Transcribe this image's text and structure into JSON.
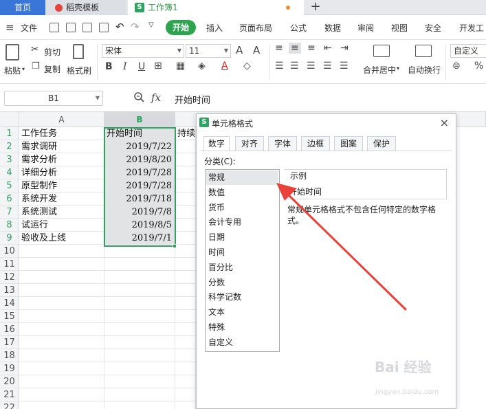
{
  "tabbar": {
    "home": "首页",
    "docer": "稻壳模板",
    "workbook": "工作簿1",
    "plus": "+"
  },
  "menubar": {
    "file": "文件",
    "start": "开始",
    "items": [
      "插入",
      "页面布局",
      "公式",
      "数据",
      "审阅",
      "视图",
      "安全",
      "开发工"
    ]
  },
  "ribbon": {
    "paste": "粘贴",
    "cut": "剪切",
    "copy": "复制",
    "format_painter": "格式刷",
    "font_name": "宋体",
    "font_size": "11",
    "merge": "合并居中",
    "wrap": "自动换行",
    "number_format": "自定义"
  },
  "formula_bar": {
    "name_box": "B1",
    "fx": "fx",
    "content": "开始时间"
  },
  "grid": {
    "col_a": "A",
    "col_b": "B",
    "rows": [
      {
        "n": "1",
        "a": "工作任务",
        "b": "开始时间",
        "c": "持续"
      },
      {
        "n": "2",
        "a": "需求调研",
        "b": "2019/7/22",
        "c": ""
      },
      {
        "n": "3",
        "a": "需求分析",
        "b": "2019/8/20",
        "c": ""
      },
      {
        "n": "4",
        "a": "详细分析",
        "b": "2019/7/28",
        "c": ""
      },
      {
        "n": "5",
        "a": "原型制作",
        "b": "2019/7/28",
        "c": ""
      },
      {
        "n": "6",
        "a": "系统开发",
        "b": "2019/7/18",
        "c": ""
      },
      {
        "n": "7",
        "a": "系统测试",
        "b": "2019/7/8",
        "c": ""
      },
      {
        "n": "8",
        "a": "试运行",
        "b": "2019/8/5",
        "c": ""
      },
      {
        "n": "9",
        "a": "验收及上线",
        "b": "2019/7/1",
        "c": ""
      },
      {
        "n": "10",
        "a": "",
        "b": "",
        "c": ""
      },
      {
        "n": "11",
        "a": "",
        "b": "",
        "c": ""
      },
      {
        "n": "12",
        "a": "",
        "b": "",
        "c": ""
      },
      {
        "n": "13",
        "a": "",
        "b": "",
        "c": ""
      },
      {
        "n": "14",
        "a": "",
        "b": "",
        "c": ""
      },
      {
        "n": "15",
        "a": "",
        "b": "",
        "c": ""
      },
      {
        "n": "16",
        "a": "",
        "b": "",
        "c": ""
      },
      {
        "n": "17",
        "a": "",
        "b": "",
        "c": ""
      },
      {
        "n": "18",
        "a": "",
        "b": "",
        "c": ""
      },
      {
        "n": "19",
        "a": "",
        "b": "",
        "c": ""
      },
      {
        "n": "20",
        "a": "",
        "b": "",
        "c": ""
      },
      {
        "n": "21",
        "a": "",
        "b": "",
        "c": ""
      },
      {
        "n": "22",
        "a": "",
        "b": "",
        "c": ""
      }
    ]
  },
  "dialog": {
    "title": "单元格格式",
    "close": "×",
    "tabs": [
      "数字",
      "对齐",
      "字体",
      "边框",
      "图案",
      "保护"
    ],
    "category_label": "分类(C):",
    "categories": [
      "常规",
      "数值",
      "货币",
      "会计专用",
      "日期",
      "时间",
      "百分比",
      "分数",
      "科学记数",
      "文本",
      "特殊",
      "自定义"
    ],
    "sample_label": "示例",
    "sample_value": "开始时间",
    "description": "常规单元格格式不包含任何特定的数字格式。"
  },
  "watermark": {
    "main": "Bai 经验",
    "sub": "jingyan.baidu.com"
  },
  "colors": {
    "accent_green": "#2ca360",
    "tab_blue": "#3a76d8",
    "arrow_red": "#e8423a"
  }
}
